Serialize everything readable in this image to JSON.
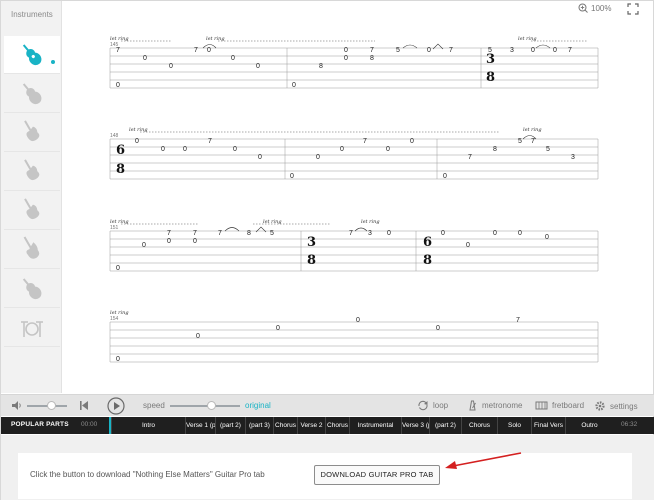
{
  "sidebar": {
    "title": "Instruments",
    "instruments": [
      {
        "icon": "acoustic-guitar-icon",
        "active": true
      },
      {
        "icon": "acoustic-guitar-icon",
        "active": false
      },
      {
        "icon": "electric-guitar-icon",
        "active": false
      },
      {
        "icon": "electric-guitar-icon",
        "active": false
      },
      {
        "icon": "electric-guitar-icon",
        "active": false
      },
      {
        "icon": "bass-guitar-icon",
        "active": false
      },
      {
        "icon": "acoustic-guitar-icon",
        "active": false
      },
      {
        "icon": "drum-kit-icon",
        "active": false
      }
    ]
  },
  "zoom": {
    "level": "100%"
  },
  "score": {
    "annotation": "let ring",
    "measures": [
      "145",
      "148",
      "151",
      "154"
    ],
    "time_signatures": [
      {
        "top": "3",
        "bottom": "8"
      },
      {
        "top": "6",
        "bottom": "8"
      },
      {
        "top": "3",
        "bottom": "8"
      },
      {
        "top": "6",
        "bottom": "8"
      }
    ],
    "notes": [
      "7",
      "0",
      "0",
      "7",
      "0",
      "0",
      "0",
      "0",
      "8",
      "0",
      "0",
      "7",
      "8",
      "5",
      "0",
      "7",
      "5",
      "3",
      "0",
      "0",
      "7",
      "0",
      "0",
      "0",
      "0",
      "7",
      "0",
      "0",
      "0",
      "0",
      "0",
      "7",
      "0",
      "0",
      "0",
      "7",
      "8",
      "5",
      "7",
      "5",
      "3",
      "0",
      "0",
      "0",
      "0",
      "0",
      "0",
      "0",
      "0",
      "0",
      "0",
      "0",
      "7"
    ]
  },
  "player": {
    "speed_label": "speed",
    "original_label": "original",
    "loop_label": "loop",
    "metronome_label": "metronome",
    "fretboard_label": "fretboard",
    "settings_label": "settings"
  },
  "parts": {
    "label": "POPULAR PARTS",
    "start_time": "00:00",
    "end_time": "06:32",
    "segments": [
      "Intro",
      "Verse 1 (p",
      "(part 2)",
      "(part 3)",
      "Chorus",
      "Verse 2",
      "Chorus",
      "Instrumental",
      "Verse 3 (p",
      "(part 2)",
      "Chorus",
      "Solo",
      "Final Vers",
      "Outro"
    ]
  },
  "download": {
    "text": "Click the button to download \"Nothing Else Matters\" Guitar Pro tab",
    "button": "DOWNLOAD GUITAR PRO TAB"
  },
  "colors": {
    "accent": "#19b3c5",
    "arrow": "#d42020"
  }
}
